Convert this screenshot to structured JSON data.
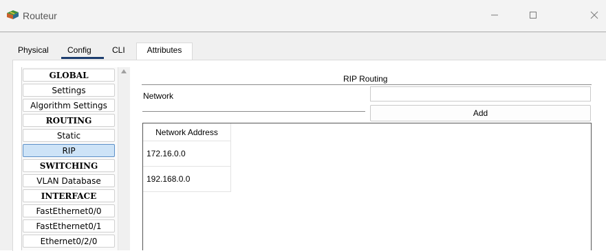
{
  "window": {
    "title": "Routeur",
    "icon": "router-app-icon",
    "controls": [
      "minimize-icon",
      "maximize-icon",
      "close-icon"
    ]
  },
  "tabs": [
    {
      "label": "Physical"
    },
    {
      "label": "Config",
      "active": true
    },
    {
      "label": "CLI"
    },
    {
      "label": "Attributes"
    }
  ],
  "nav": {
    "items": [
      {
        "label": "GLOBAL",
        "type": "header"
      },
      {
        "label": "Settings"
      },
      {
        "label": "Algorithm Settings"
      },
      {
        "label": "ROUTING",
        "type": "header"
      },
      {
        "label": "Static"
      },
      {
        "label": "RIP",
        "selected": true
      },
      {
        "label": "SWITCHING",
        "type": "header"
      },
      {
        "label": "VLAN Database"
      },
      {
        "label": "INTERFACE",
        "type": "header"
      },
      {
        "label": "FastEthernet0/0"
      },
      {
        "label": "FastEthernet0/1"
      },
      {
        "label": "Ethernet0/2/0"
      }
    ]
  },
  "rip": {
    "title": "RIP Routing",
    "network_label": "Network",
    "network_value": "",
    "add_label": "Add",
    "table": {
      "header": "Network Address",
      "rows": [
        "172.16.0.0",
        "192.168.0.0"
      ]
    }
  },
  "colors": {
    "selected_bg": "#cde3f7",
    "selected_border": "#5b8fc7",
    "active_tab_underline": "#1b3c6e"
  }
}
